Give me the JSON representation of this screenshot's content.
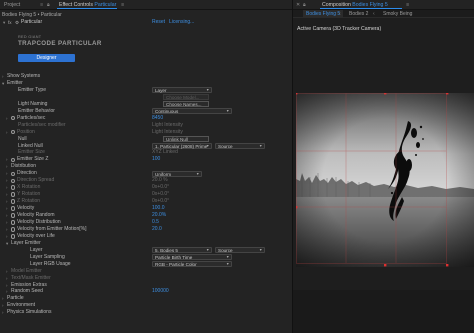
{
  "left_panel": {
    "tabs": [
      "Project",
      "Effect Controls",
      "Particular"
    ],
    "breadcrumb": "Bodies Flying 5 • Particular",
    "effect_name": "Particular",
    "reset_label": "Reset",
    "licensing_label": "Licensing...",
    "logo_small": "RED GIANT",
    "logo_main": "TRAPCODE PARTICULAR",
    "designer_label": "Designer",
    "rows": [
      {
        "indent": 1,
        "twirl": "closed",
        "label": "Show Systems"
      },
      {
        "indent": 1,
        "twirl": "open",
        "label": "Emitter"
      },
      {
        "indent": 2,
        "label": "Emitter Type",
        "dropdown": "Layer",
        "dd_w": 60
      },
      {
        "indent": 2,
        "label": "",
        "button": "Choose Model...",
        "disabled": true
      },
      {
        "indent": 2,
        "label": "Light Naming",
        "button": "Choose Names..."
      },
      {
        "indent": 2,
        "label": "Emitter Behavior",
        "dropdown": "Continuous",
        "dd_w": 80
      },
      {
        "indent": 2,
        "twirl": "closed",
        "stopwatch": true,
        "label": "Particles/sec",
        "value": "8450",
        "blue": true
      },
      {
        "indent": 2,
        "label": "Particles/sec modifier",
        "value": "Light Intensity",
        "dim": true,
        "dim_value": true
      },
      {
        "indent": 2,
        "twirl": "closed",
        "stopwatch": true,
        "label": "Position",
        "value": "Light Intensity",
        "dim": true,
        "dim_value": true
      },
      {
        "indent": 2,
        "label": "Null",
        "button": "Unlink Null"
      },
      {
        "indent": 2,
        "label": "Linked Null",
        "dropdown": "1. Particular (2608) Prime",
        "dd_w": 60,
        "dropdown2": "Source",
        "dd2_w": 50
      },
      {
        "indent": 2,
        "label": "Emitter Size",
        "value": "XYZ Linked",
        "dim": true,
        "dim_value": true
      },
      {
        "indent": 2,
        "twirl": "closed",
        "stopwatch": true,
        "label": "Emitter Size Z",
        "value": "100",
        "blue": true
      },
      {
        "indent": 2,
        "twirl": "closed",
        "label": "Distribution"
      },
      {
        "indent": 2,
        "twirl": "closed",
        "stopwatch": true,
        "label": "Direction",
        "dropdown": "Uniform",
        "dd_w": 50
      },
      {
        "indent": 2,
        "twirl": "closed",
        "stopwatch": true,
        "label": "Direction Spread",
        "value": "20.0 %",
        "dim": true,
        "dim_value": true
      },
      {
        "indent": 2,
        "twirl": "closed",
        "stopwatch": true,
        "label": "X Rotation",
        "value": "0x+0.0°",
        "dim": true,
        "dim_value": true
      },
      {
        "indent": 2,
        "twirl": "closed",
        "stopwatch": true,
        "label": "Y Rotation",
        "value": "0x+0.0°",
        "dim": true,
        "dim_value": true
      },
      {
        "indent": 2,
        "twirl": "closed",
        "stopwatch": true,
        "label": "Z Rotation",
        "value": "0x+0.0°",
        "dim": true,
        "dim_value": true
      },
      {
        "indent": 2,
        "twirl": "closed",
        "stopwatch": true,
        "label": "Velocity",
        "value": "100.0",
        "blue": true
      },
      {
        "indent": 2,
        "twirl": "closed",
        "stopwatch": true,
        "label": "Velocity Random",
        "value": "20.0%",
        "blue": true
      },
      {
        "indent": 2,
        "twirl": "closed",
        "stopwatch": true,
        "label": "Velocity Distribution",
        "value": "0.5",
        "blue": true
      },
      {
        "indent": 2,
        "twirl": "closed",
        "stopwatch": true,
        "label": "Velocity from Emitter Motion[%]",
        "value": "20.0",
        "blue": true
      },
      {
        "indent": 2,
        "twirl": "closed",
        "stopwatch": true,
        "label": "Velocity over Life"
      },
      {
        "indent": 2,
        "twirl": "open",
        "label": "Layer Emitter"
      },
      {
        "indent": 3,
        "label": "Layer",
        "dropdown": "5. Bodies 5",
        "dd_w": 60,
        "dropdown2": "Source",
        "dd2_w": 50
      },
      {
        "indent": 3,
        "label": "Layer Sampling",
        "dropdown": "Particle Birth Time",
        "dd_w": 80
      },
      {
        "indent": 3,
        "label": "Layer RGB Usage",
        "dropdown": "RGB - Particle Color",
        "dd_w": 80
      },
      {
        "indent": 2,
        "twirl": "closed",
        "label": "Model Emitter",
        "dim": true
      },
      {
        "indent": 2,
        "twirl": "closed",
        "label": "Text/Mask Emitter",
        "dim": true
      },
      {
        "indent": 2,
        "twirl": "closed",
        "label": "Emission Extras"
      },
      {
        "indent": 2,
        "twirl": "closed",
        "label": "Random Seed",
        "value": "100000",
        "blue": true
      },
      {
        "indent": 1,
        "twirl": "closed",
        "label": "Particle"
      },
      {
        "indent": 1,
        "twirl": "closed",
        "label": "Environment"
      },
      {
        "indent": 1,
        "twirl": "closed",
        "label": "Physics Simulations"
      }
    ]
  },
  "right_panel": {
    "composition_label": "Composition",
    "composition_name": "Bodies Flying 5",
    "tabs": [
      "Bodies Flying 5",
      "Bodies 2",
      "Smoky Being"
    ],
    "camera_label": "Active Camera (3D Tracker Camera)"
  },
  "colors": {
    "accent": "#2d8ceb",
    "value_blue": "#3d8ee0",
    "designer_button": "#2d72d2",
    "panel_bg": "#232323",
    "viewer_bg": "#1e1e1e"
  }
}
